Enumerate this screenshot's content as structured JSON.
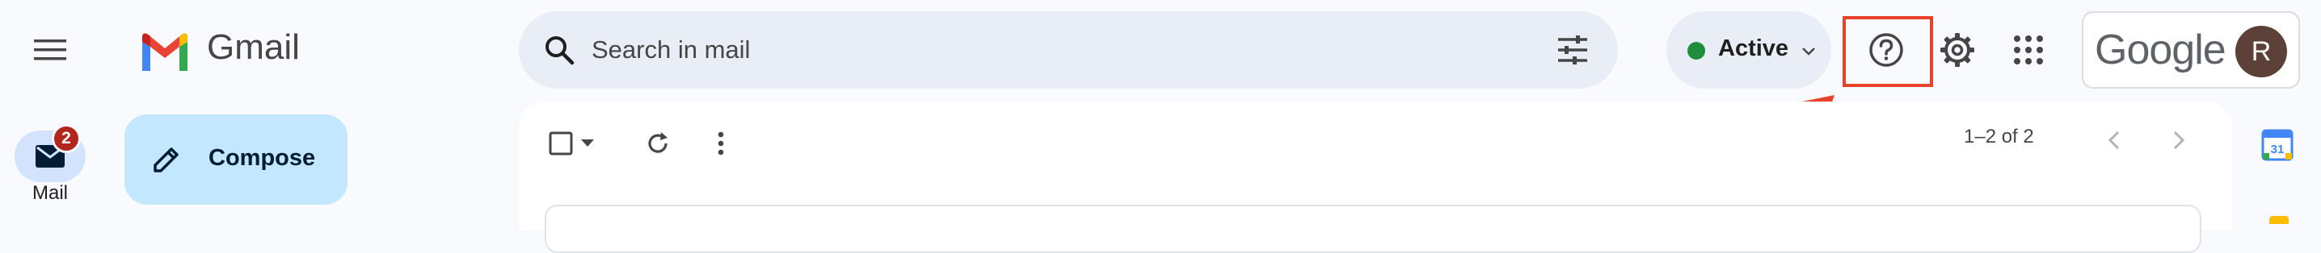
{
  "app": {
    "logo_text": "Gmail"
  },
  "nav": {
    "mail_label": "Mail",
    "mail_badge": "2"
  },
  "compose": {
    "label": "Compose"
  },
  "search": {
    "placeholder": "Search in mail",
    "value": ""
  },
  "status": {
    "label": "Active",
    "color": "#1e8e3e"
  },
  "header_icons": {
    "help": "help-circle-icon",
    "settings": "gear-icon",
    "apps": "apps-grid-icon"
  },
  "account": {
    "brand": "Google",
    "avatar_initial": "R",
    "avatar_color": "#5d4037"
  },
  "toolbar": {
    "pagination": "1–2 of 2"
  },
  "colors": {
    "accent": "#c2e7ff",
    "badge": "#b3261e",
    "highlight": "#e8432a",
    "surface": "#e9eef6"
  },
  "side_panel": {
    "calendar_day": "31"
  }
}
